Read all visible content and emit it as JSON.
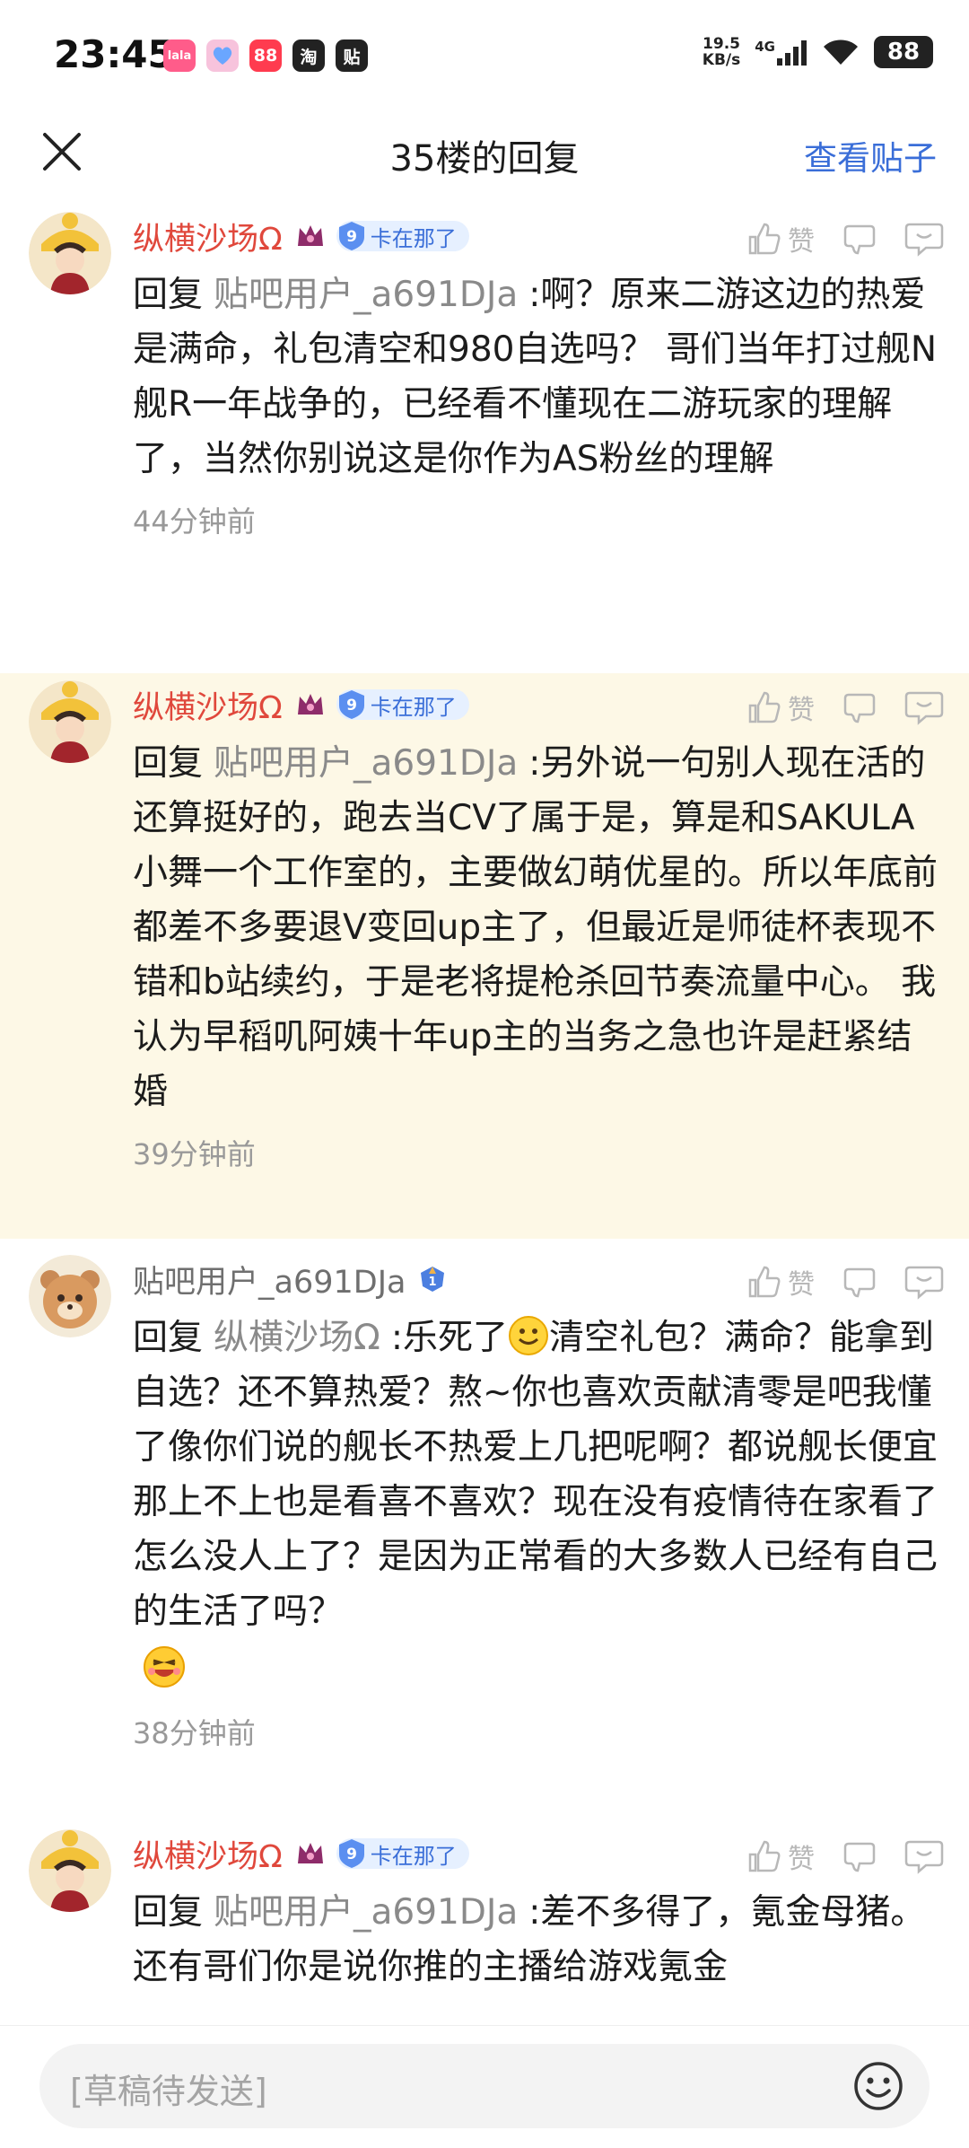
{
  "status_bar": {
    "time": "23:45",
    "net_speed_value": "19.5",
    "net_speed_unit": "KB/s",
    "network_type": "4G",
    "battery": "88",
    "app_icons": [
      {
        "label": "lala",
        "color": "#ff5c8a"
      },
      {
        "label": "",
        "color": "#f7c3dc"
      },
      {
        "label": "88",
        "color": "#ff3b4f"
      },
      {
        "label": "淘",
        "color": "#222222"
      },
      {
        "label": "贴",
        "color": "#222222"
      }
    ]
  },
  "header": {
    "title": "35楼的回复",
    "view_post": "查看贴子"
  },
  "like_label": "赞",
  "comments": [
    {
      "user": "纵横沙场Ω",
      "badge_level": "9",
      "badge_label": "卡在那了",
      "reply_prefix": "回复",
      "reply_target": "贴吧用户_a691DJa",
      "text": ":啊？原来二游这边的热爱是满命，礼包清空和980自选吗？ 哥们当年打过舰N舰R一年战争的，已经看不懂现在二游玩家的理解了，当然你别说这是你作为AS粉丝的理解",
      "time": "44分钟前"
    },
    {
      "user": "纵横沙场Ω",
      "badge_level": "9",
      "badge_label": "卡在那了",
      "reply_prefix": "回复",
      "reply_target": "贴吧用户_a691DJa",
      "text": ":另外说一句别人现在活的还算挺好的，跑去当CV了属于是，算是和SAKULA小舞一个工作室的，主要做幻萌优星的。所以年底前都差不多要退V变回up主了，但最近是师徒杯表现不错和b站续约，于是老将提枪杀回节奏流量中心。 我认为早稻叽阿姨十年up主的当务之急也许是赶紧结婚",
      "time": "39分钟前"
    },
    {
      "user": "贴吧用户_a691DJa",
      "reply_prefix": "回复",
      "reply_target": "纵横沙场Ω",
      "text_a": ":乐死了",
      "text_b": "清空礼包？满命？能拿到自选？还不算热爱？熬~你也喜欢贡献清零是吧我懂了像你们说的舰长不热爱上几把呢啊？都说舰长便宜那上不上也是看喜不喜欢？现在没有疫情待在家看了怎么没人上了？是因为正常看的大多数人已经有自己的生活了吗？",
      "time": "38分钟前"
    },
    {
      "user": "纵横沙场Ω",
      "badge_level": "9",
      "badge_label": "卡在那了",
      "reply_prefix": "回复",
      "reply_target": "贴吧用户_a691DJa",
      "text": ":差不多得了，氪金母猪。还有哥们你是说你推的主播给游戏氪金"
    }
  ],
  "bottom_bar": {
    "draft_placeholder": "[草稿待发送]"
  }
}
